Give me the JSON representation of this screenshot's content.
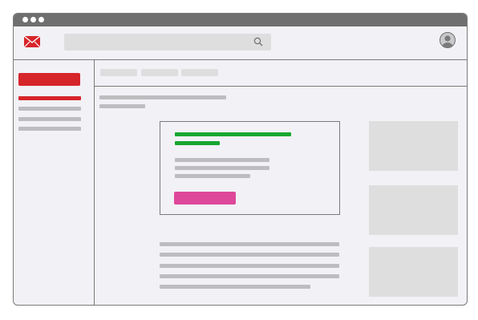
{
  "window": {
    "controls": [
      "dot",
      "dot",
      "dot"
    ]
  },
  "header": {
    "logo_icon": "mail-envelope-icon",
    "search": {
      "placeholder": "",
      "icon": "search-icon"
    },
    "avatar_icon": "user-avatar-icon"
  },
  "sidebar": {
    "compose_icon": "compose-button",
    "nav_items": 4
  },
  "tabs": {
    "count": 3
  },
  "colors": {
    "brand": "#d6252a",
    "accent_green": "#17a72f",
    "cta": "#de479a",
    "chrome": "#6f6f6f",
    "background": "#f2f1f6",
    "placeholder": "#bdbdc0"
  }
}
